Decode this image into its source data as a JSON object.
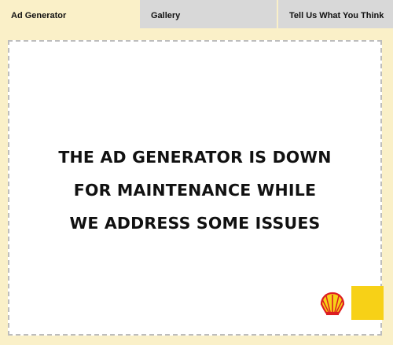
{
  "tabs": [
    {
      "label": "Ad Generator",
      "active": true
    },
    {
      "label": "Gallery",
      "active": false
    },
    {
      "label": "Tell Us What You Think",
      "active": false
    }
  ],
  "main": {
    "message_lines": [
      "THE AD GENERATOR IS DOWN",
      "FOR MAINTENANCE WHILE",
      "WE ADDRESS SOME ISSUES"
    ]
  },
  "colors": {
    "frame_cream": "#faf0c8",
    "inactive_tab": "#d8d8d8",
    "brand_yellow": "#f7d117",
    "brand_red": "#dd1d21"
  },
  "icons": [
    "shell-logo-icon"
  ]
}
